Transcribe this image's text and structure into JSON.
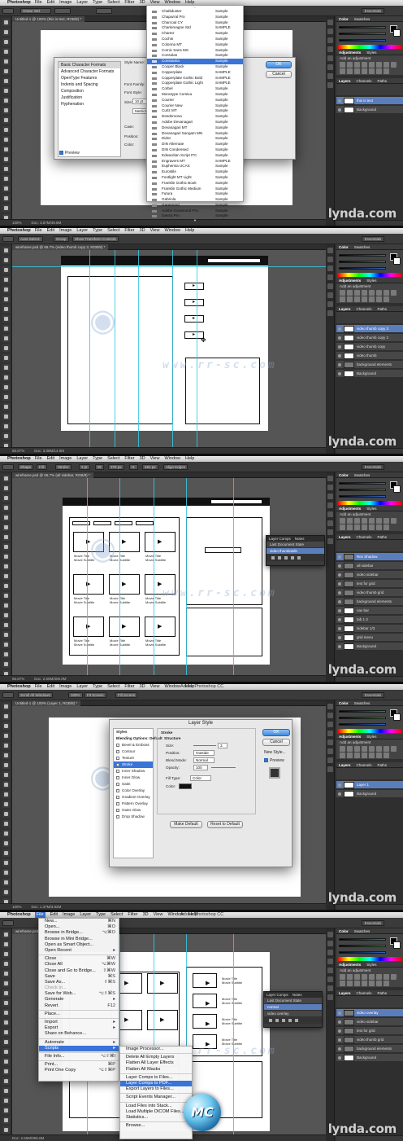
{
  "menubar": {
    "app": "Photoshop",
    "items": [
      "File",
      "Edit",
      "Image",
      "Layer",
      "Type",
      "Select",
      "Filter",
      "3D",
      "View",
      "Window",
      "Help"
    ],
    "window_title": "Adobe Photoshop CC"
  },
  "workspace": "Essentials",
  "watermark": {
    "site": "www.rr-sc.com",
    "lynda": "lynda.com",
    "logo": "MC"
  },
  "panels": {
    "color_tabs": [
      "Color",
      "Swatches"
    ],
    "adjustments_tabs": [
      "Adjustments",
      "Styles"
    ],
    "adjustments_hint": "Add an adjustment",
    "layers_tabs": [
      "Layers",
      "Channels",
      "Paths"
    ]
  },
  "shot1": {
    "tab": "Untitled-1 @ 100% (this is text, RGB/8) *",
    "status": "Doc: 3.57M/49.8M",
    "zoom": "100%",
    "font_field": "Orator Std",
    "dialog": {
      "sidebar": [
        "Basic Character Formats",
        "Advanced Character Formats",
        "OpenType Features",
        "Indents and Spacing",
        "Composition",
        "Justification",
        "Hyphenation"
      ],
      "fields": [
        "Style Name:",
        "Font Family:",
        "Font Style:",
        "Size:",
        "Case:",
        "Position:",
        "Color:"
      ],
      "size_value": "10 pt",
      "metrics": "Metrics",
      "preview": "Preview",
      "ok": "OK",
      "cancel": "Cancel"
    },
    "fontmenu": [
      {
        "name": "Chalkduster",
        "sample": "Sample"
      },
      {
        "name": "Chaparral Pro",
        "sample": "Sample"
      },
      {
        "name": "Charcoal CY",
        "sample": "Sample"
      },
      {
        "name": "Charlemagne Std",
        "sample": "SAMPLE"
      },
      {
        "name": "Charter",
        "sample": "Sample"
      },
      {
        "name": "Cochin",
        "sample": "Sample"
      },
      {
        "name": "Colonna MT",
        "sample": "Sample"
      },
      {
        "name": "Comic Sans MS",
        "sample": "Sample"
      },
      {
        "name": "Consolas",
        "sample": "Sample"
      },
      {
        "name": "Constantia",
        "sample": "Sample"
      },
      {
        "name": "Cooper Black",
        "sample": "Sample"
      },
      {
        "name": "Copperplate",
        "sample": "SAMPLE"
      },
      {
        "name": "Copperplate Gothic Bold",
        "sample": "SAMPLE"
      },
      {
        "name": "Copperplate Gothic Light",
        "sample": "SAMPLE"
      },
      {
        "name": "Corbel",
        "sample": "Sample"
      },
      {
        "name": "Monotype Corsiva",
        "sample": "Sample"
      },
      {
        "name": "Courier",
        "sample": "Sample"
      },
      {
        "name": "Courier New",
        "sample": "Sample"
      },
      {
        "name": "Curlz MT",
        "sample": "Sample"
      },
      {
        "name": "Desdemona",
        "sample": "Sample"
      },
      {
        "name": "Adobe Devanagari",
        "sample": "Sample"
      },
      {
        "name": "Devanagari MT",
        "sample": "Sample"
      },
      {
        "name": "Devanagari Sangam MN",
        "sample": "Sample"
      },
      {
        "name": "Didot",
        "sample": "Sample"
      },
      {
        "name": "DIN Alternate",
        "sample": "Sample"
      },
      {
        "name": "DIN Condensed",
        "sample": "Sample"
      },
      {
        "name": "Edwardian Script ITC",
        "sample": "Sample"
      },
      {
        "name": "Engravers MT",
        "sample": "SAMPLE"
      },
      {
        "name": "Euphemia UCAS",
        "sample": "Sample"
      },
      {
        "name": "Eurostile",
        "sample": "Sample"
      },
      {
        "name": "Footlight MT Light",
        "sample": "Sample"
      },
      {
        "name": "Franklin Gothic Book",
        "sample": "Sample"
      },
      {
        "name": "Franklin Gothic Medium",
        "sample": "Sample"
      },
      {
        "name": "Futura",
        "sample": "Sample"
      },
      {
        "name": "Gabriola",
        "sample": "Sample"
      },
      {
        "name": "Garamond",
        "sample": "Sample"
      },
      {
        "name": "Adobe Garamond Pro",
        "sample": "Sample"
      },
      {
        "name": "Geeza Pro",
        "sample": "Sample"
      }
    ],
    "layers": [
      {
        "name": "this is text",
        "type": "text",
        "selected": true
      },
      {
        "name": "Background",
        "type": "image",
        "selected": false
      }
    ]
  },
  "shot2": {
    "tab": "wireframe.psd @ 66.7% (video thumb copy 3, RGB/8) *",
    "status": "Doc: 3.08M/14.0M",
    "zoom": "66.67%",
    "options": [
      "Auto-Select:",
      "Group",
      "Show Transform Controls"
    ],
    "layers": [
      {
        "name": "video thumb copy 3",
        "type": "image",
        "selected": true
      },
      {
        "name": "video thumb copy 2",
        "type": "image",
        "selected": false
      },
      {
        "name": "video thumb copy",
        "type": "image",
        "selected": false
      },
      {
        "name": "video thumb",
        "type": "image",
        "selected": false
      },
      {
        "name": "background elements",
        "type": "folder",
        "selected": false
      },
      {
        "name": "Background",
        "type": "image",
        "selected": false
      }
    ]
  },
  "shot3": {
    "tab": "wireframe.psd @ 66.7% (all sidebar, RGB/8) *",
    "status": "Doc: 2.60M/306.0M",
    "zoom": "66.67%",
    "options": [
      "Shape",
      "Fill:",
      "Stroke:",
      "3 pt",
      "W:",
      "375 px",
      "H:",
      "481 px",
      "Align Edges"
    ],
    "comps_panel": {
      "tabs": [
        "Layer Comps",
        "Notes"
      ],
      "rows": [
        "Last Document State",
        "video thumbnails"
      ]
    },
    "captions": [
      "Movie Title",
      "Movie Subtitle"
    ],
    "layers": [
      {
        "name": "Rex Shadow",
        "type": "folder",
        "selected": true
      },
      {
        "name": "all sidebar",
        "type": "folder",
        "selected": false
      },
      {
        "name": "video sidebar",
        "type": "folder",
        "selected": false
      },
      {
        "name": "text for grid",
        "type": "folder",
        "selected": false
      },
      {
        "name": "video thumb grid",
        "type": "folder",
        "selected": false
      },
      {
        "name": "background elements",
        "type": "folder",
        "selected": false
      },
      {
        "name": "nav bar",
        "type": "image",
        "selected": false
      },
      {
        "name": "tab 1 3",
        "type": "image",
        "selected": false
      },
      {
        "name": "sidebar 1/3",
        "type": "image",
        "selected": false
      },
      {
        "name": "grid menu",
        "type": "image",
        "selected": false
      },
      {
        "name": "Background",
        "type": "image",
        "selected": false
      }
    ]
  },
  "shot4": {
    "tab": "Untitled-1 @ 100% (Layer 1, RGB/8) *",
    "status": "Doc: 1.37M/3.82M",
    "zoom": "100%",
    "options": [
      "Scroll All Windows",
      "100%",
      "Fit Screen",
      "Fill Screen"
    ],
    "dialog": {
      "title": "Layer Style",
      "styles": [
        {
          "label": "Styles",
          "kind": "header"
        },
        {
          "label": "Blending Options: Default",
          "kind": "header"
        },
        {
          "label": "Bevel & Emboss",
          "kind": "check"
        },
        {
          "label": "Contour",
          "kind": "check"
        },
        {
          "label": "Texture",
          "kind": "check"
        },
        {
          "label": "Stroke",
          "kind": "check",
          "selected": true
        },
        {
          "label": "Inner Shadow",
          "kind": "check"
        },
        {
          "label": "Inner Glow",
          "kind": "check"
        },
        {
          "label": "Satin",
          "kind": "check"
        },
        {
          "label": "Color Overlay",
          "kind": "check"
        },
        {
          "label": "Gradient Overlay",
          "kind": "check"
        },
        {
          "label": "Pattern Overlay",
          "kind": "check"
        },
        {
          "label": "Outer Glow",
          "kind": "check"
        },
        {
          "label": "Drop Shadow",
          "kind": "check"
        }
      ],
      "section": "Stroke",
      "structure": "Structure",
      "size_label": "Size:",
      "size_value": "3",
      "position_label": "Position:",
      "position_value": "Outside",
      "blend_label": "Blend Mode:",
      "blend_value": "Normal",
      "opacity_label": "Opacity:",
      "opacity_value": "100",
      "filltype_label": "Fill Type:",
      "filltype_value": "Color",
      "color_label": "Color:",
      "make_default": "Make Default",
      "reset_default": "Reset to Default",
      "ok": "OK",
      "cancel": "Cancel",
      "new_style": "New Style...",
      "preview": "Preview"
    },
    "layers": [
      {
        "name": "Layer 1",
        "type": "image",
        "selected": true
      },
      {
        "name": "Background",
        "type": "image",
        "selected": false
      }
    ]
  },
  "shot5": {
    "tab": "wireframe.psd",
    "status": "Doc: 2.60M/306.0M",
    "file_menu": [
      {
        "label": "New...",
        "sc": "⌘N"
      },
      {
        "label": "Open...",
        "sc": "⌘O"
      },
      {
        "label": "Browse in Bridge...",
        "sc": "⌥⌘O"
      },
      {
        "label": "Browse in Mini Bridge...",
        "sc": ""
      },
      {
        "label": "Open as Smart Object...",
        "sc": ""
      },
      {
        "label": "Open Recent",
        "sc": "▸"
      },
      {
        "sep": true
      },
      {
        "label": "Close",
        "sc": "⌘W"
      },
      {
        "label": "Close All",
        "sc": "⌥⌘W"
      },
      {
        "label": "Close and Go to Bridge...",
        "sc": "⇧⌘W"
      },
      {
        "label": "Save",
        "sc": "⌘S"
      },
      {
        "label": "Save As...",
        "sc": "⇧⌘S"
      },
      {
        "label": "Check In...",
        "sc": "",
        "dis": true
      },
      {
        "label": "Save for Web...",
        "sc": "⌥⇧⌘S"
      },
      {
        "label": "Generate",
        "sc": "▸"
      },
      {
        "label": "Revert",
        "sc": "F12"
      },
      {
        "sep": true
      },
      {
        "label": "Place...",
        "sc": ""
      },
      {
        "sep": true
      },
      {
        "label": "Import",
        "sc": "▸"
      },
      {
        "label": "Export",
        "sc": "▸"
      },
      {
        "label": "Share on Behance...",
        "sc": ""
      },
      {
        "sep": true
      },
      {
        "label": "Automate",
        "sc": "▸"
      },
      {
        "label": "Scripts",
        "sc": "▸",
        "sel": true
      },
      {
        "sep": true
      },
      {
        "label": "File Info...",
        "sc": "⌥⇧⌘I"
      },
      {
        "sep": true
      },
      {
        "label": "Print...",
        "sc": "⌘P"
      },
      {
        "label": "Print One Copy",
        "sc": "⌥⇧⌘P"
      }
    ],
    "scripts_menu": [
      {
        "label": "Image Processor..."
      },
      {
        "sep": true
      },
      {
        "label": "Delete All Empty Layers"
      },
      {
        "label": "Flatten All Layer Effects"
      },
      {
        "label": "Flatten All Masks"
      },
      {
        "sep": true
      },
      {
        "label": "Layer Comps to Files..."
      },
      {
        "label": "Layer Comps to PDF...",
        "sel": true
      },
      {
        "label": "Export Layers to Files..."
      },
      {
        "sep": true
      },
      {
        "label": "Script Events Manager..."
      },
      {
        "sep": true
      },
      {
        "label": "Load Files into Stack..."
      },
      {
        "label": "Load Multiple DICOM Files..."
      },
      {
        "label": "Statistics..."
      },
      {
        "sep": true
      },
      {
        "label": "Browse..."
      }
    ],
    "comps_panel": {
      "tabs": [
        "Layer Comps",
        "Notes"
      ],
      "rows": [
        "Last Document State",
        "normal",
        "video overlay"
      ]
    },
    "captions": [
      "Movie Title",
      "Movie Subtitle"
    ],
    "layers": [
      {
        "name": "video overlay",
        "type": "folder",
        "selected": true
      },
      {
        "name": "video sidebar",
        "type": "folder",
        "selected": false
      },
      {
        "name": "text for grid",
        "type": "folder",
        "selected": false
      },
      {
        "name": "video thumb grid",
        "type": "folder",
        "selected": false
      },
      {
        "name": "background elements",
        "type": "folder",
        "selected": false
      },
      {
        "name": "Background",
        "type": "image",
        "selected": false
      }
    ]
  }
}
